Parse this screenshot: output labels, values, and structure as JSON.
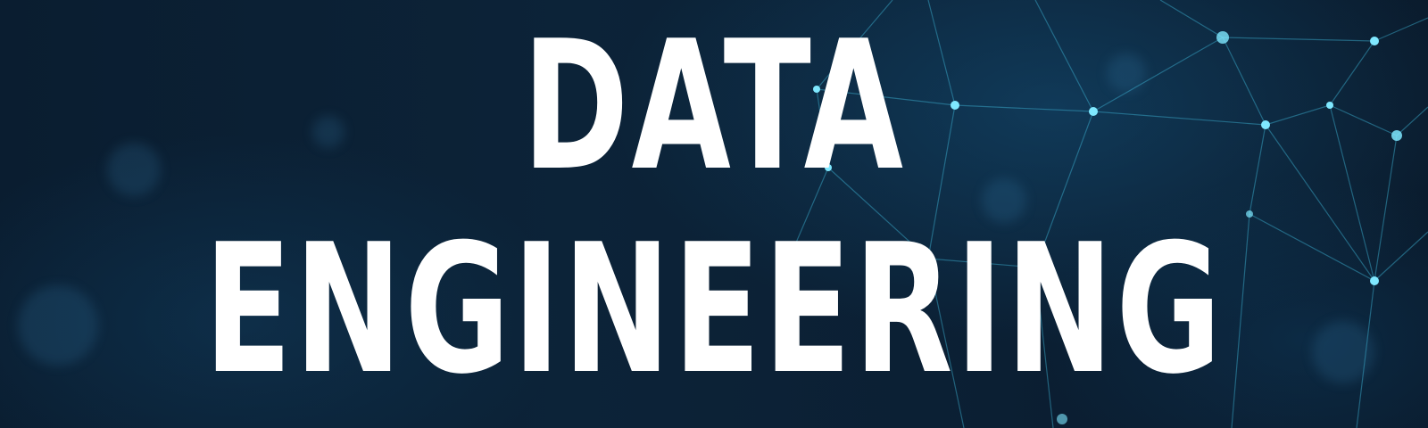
{
  "banner": {
    "title_line_1": "DATA",
    "title_line_2": "ENGINEERING"
  },
  "background": {
    "motif": "network-graph-nodes",
    "base_color": "#0b1f33",
    "node_color": "#7fe8ff",
    "line_color": "#3fb6d6"
  },
  "text_color": "#ffffff"
}
